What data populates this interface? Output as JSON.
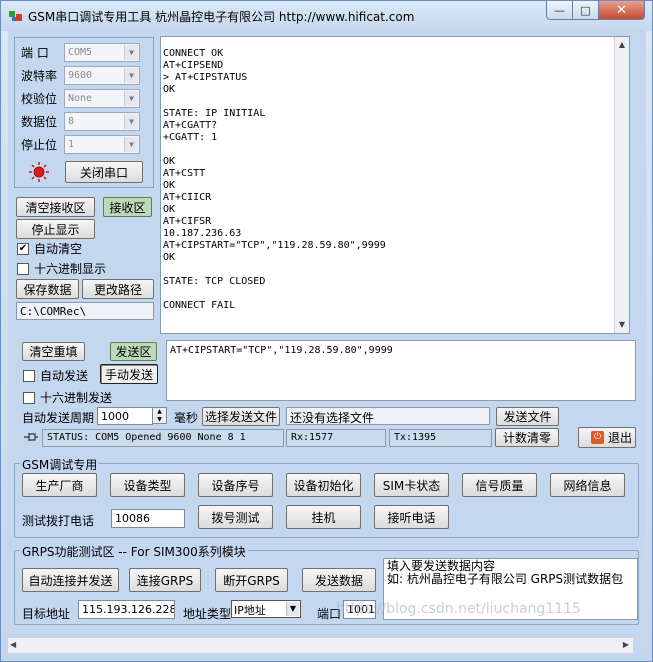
{
  "window": {
    "title": "GSM串口调试专用工具 杭州晶控电子有限公司  http://www.hificat.com",
    "min_glyph": "—",
    "max_glyph": "□",
    "close_glyph": "✕"
  },
  "port_config": {
    "port_label": "端  口",
    "port_value": "COM5",
    "baud_label": "波特率",
    "baud_value": "9600",
    "parity_label": "校验位",
    "parity_value": "None",
    "databits_label": "数据位",
    "databits_value": "8",
    "stopbits_label": "停止位",
    "stopbits_value": "1",
    "close_port_button": "关闭串口"
  },
  "receive_panel": {
    "clear_button": "清空接收区",
    "area_badge": "接收区",
    "stop_display_button": "停止显示",
    "auto_clear_label": "自动清空",
    "hex_display_label": "十六进制显示",
    "save_button": "保存数据",
    "change_path_button": "更改路径",
    "path": "C:\\COMRec\\"
  },
  "receive_text": "CONNECT OK\nAT+CIPSEND\n> AT+CIPSTATUS\nOK\n\nSTATE: IP INITIAL\nAT+CGATT?\n+CGATT: 1\n\nOK\nAT+CSTT\nOK\nAT+CIICR\nOK\nAT+CIFSR\n10.187.236.63\nAT+CIPSTART=\"TCP\",\"119.28.59.80\",9999\nOK\n\nSTATE: TCP CLOSED\n\nCONNECT FAIL",
  "send_panel": {
    "clear_resend_button": "清空重填",
    "area_badge": "发送区",
    "auto_send_label": "自动发送",
    "manual_send_button": "手动发送",
    "hex_send_label": "十六进制发送",
    "period_label": "自动发送周期",
    "period_value": "1000",
    "ms_label": "毫秒",
    "select_file_button": "选择发送文件",
    "no_file_text": "还没有选择文件",
    "send_file_button": "发送文件",
    "count_clear_button": "计数清零",
    "exit_button": "退出",
    "send_text": "AT+CIPSTART=\"TCP\",\"119.28.59.80\",9999"
  },
  "status_bar": {
    "status": "STATUS: COM5 Opened 9600 None 8 1",
    "rx": "Rx:1577",
    "tx": "Tx:1395"
  },
  "gsm_group": {
    "title": "GSM调试专用",
    "buttons": [
      "生产厂商",
      "设备类型",
      "设备序号",
      "设备初始化",
      "SIM卡状态",
      "信号质量",
      "网络信息"
    ],
    "dial_label": "测试拨打电话",
    "dial_number": "10086",
    "dial_button": "拨号测试",
    "hangup_button": "挂机",
    "answer_button": "接听电话"
  },
  "gprs_group": {
    "title": "GRPS功能测试区 -- For SIM300系列模块",
    "auto_connect_button": "自动连接并发送",
    "connect_button": "连接GRPS",
    "disconnect_button": "断开GRPS",
    "send_data_button": "发送数据",
    "text_line1": "填入要发送数据内容",
    "text_line2": "如: 杭州晶控电子有限公司  GRPS测试数据包",
    "target_label": "目标地址",
    "target_value": "115.193.126.228",
    "addr_type_label": "地址类型",
    "addr_type_value": "IP地址",
    "port_label": "端口",
    "port_value": "1001"
  },
  "watermark": "https://blog.csdn.net/liuchang1115"
}
